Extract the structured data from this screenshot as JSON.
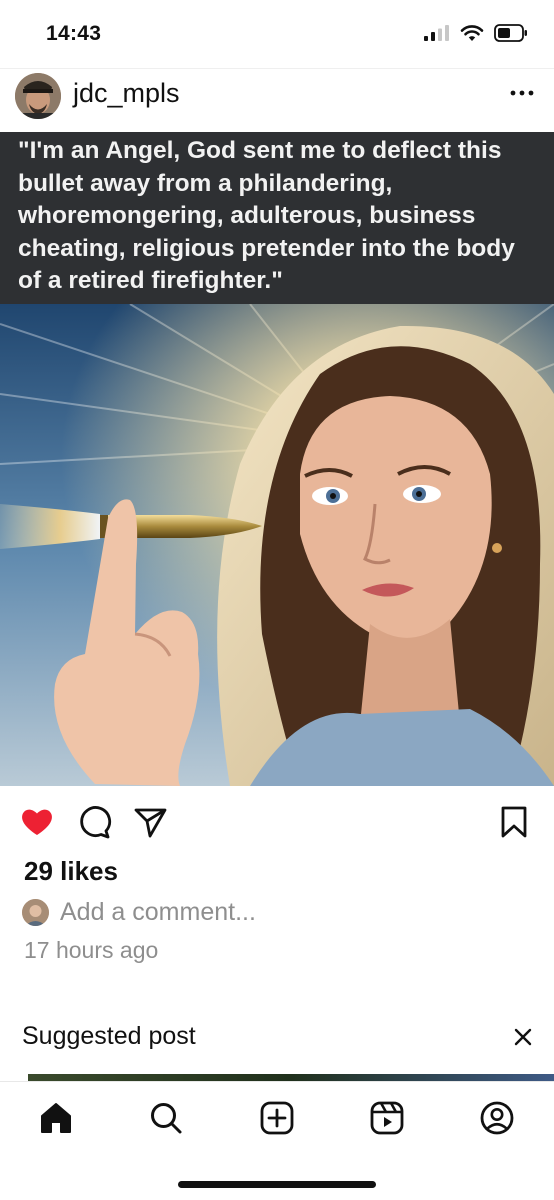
{
  "status_bar": {
    "time": "14:43"
  },
  "post": {
    "username": "jdc_mpls",
    "caption_overlay": "\"I'm an Angel, God sent me to deflect this bullet away from a philandering, whoremongering, adulterous, business cheating, religious pretender into the body of a retired firefighter.\"",
    "liked": true,
    "likes_text": "29 likes",
    "comment_placeholder": "Add a comment...",
    "timestamp": "17 hours ago"
  },
  "suggested": {
    "label": "Suggested post"
  },
  "icons": {
    "like": "heart-filled-icon",
    "comment": "comment-icon",
    "share": "send-icon",
    "save": "bookmark-icon",
    "more": "more-horizontal-icon",
    "close": "close-icon"
  },
  "tab_bar": {
    "items": [
      "home-icon",
      "search-icon",
      "create-icon",
      "reels-icon",
      "profile-icon"
    ],
    "active": "home-icon"
  },
  "colors": {
    "like": "#ed2133",
    "caption_band": "#2e3033",
    "muted_text": "#8e8e8e"
  }
}
